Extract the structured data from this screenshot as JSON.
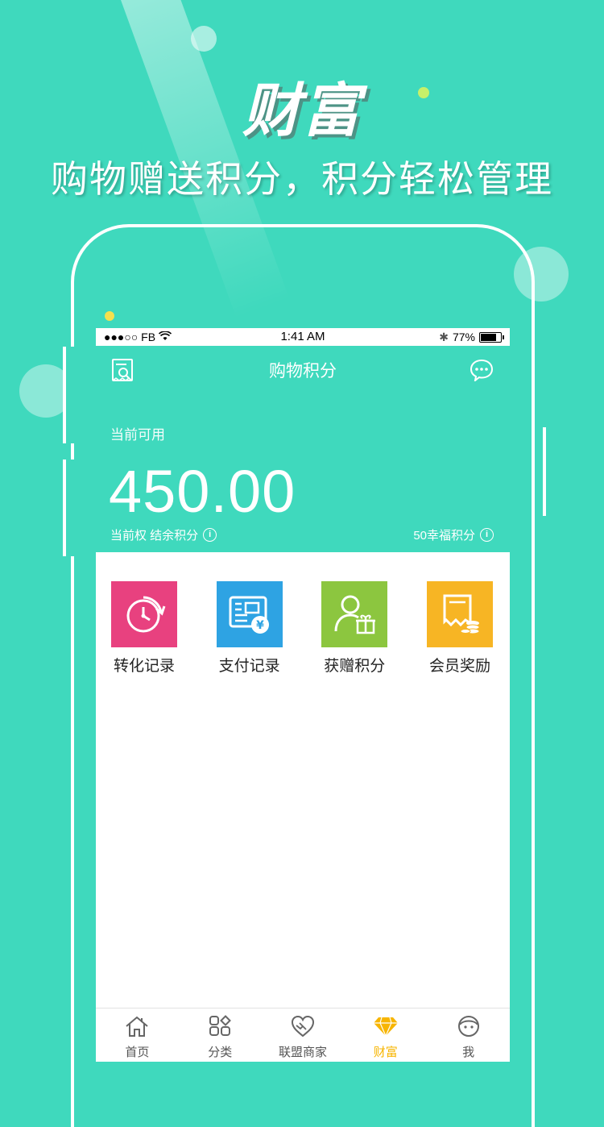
{
  "promo": {
    "title": "财富",
    "subtitle": "购物赠送积分，积分轻松管理"
  },
  "status_bar": {
    "carrier": "●●●○○ FB",
    "time": "1:41 AM",
    "battery": "77%"
  },
  "header": {
    "title": "购物积分",
    "left_icon": "receipt-search-icon",
    "right_icon": "chat-bubble-icon"
  },
  "balance": {
    "label": "当前可用",
    "value": "450.00",
    "sub_left": "当前权  结余积分",
    "sub_right": "50幸福积分"
  },
  "actions": [
    {
      "label": "转化记录",
      "icon": "timer-history-icon",
      "color": "#e8417f"
    },
    {
      "label": "支付记录",
      "icon": "payment-card-icon",
      "color": "#2ea3e3"
    },
    {
      "label": "获赠积分",
      "icon": "user-gift-icon",
      "color": "#8cc63f"
    },
    {
      "label": "会员奖励",
      "icon": "receipt-coins-icon",
      "color": "#f7b524"
    }
  ],
  "tabbar": [
    {
      "label": "首页",
      "icon": "home-icon",
      "active": false
    },
    {
      "label": "分类",
      "icon": "category-grid-icon",
      "active": false
    },
    {
      "label": "联盟商家",
      "icon": "handshake-heart-icon",
      "active": false
    },
    {
      "label": "财富",
      "icon": "diamond-icon",
      "active": true
    },
    {
      "label": "我",
      "icon": "face-icon",
      "active": false
    }
  ],
  "colors": {
    "brand": "#3fd9bd",
    "tab_active": "#f7b500"
  }
}
